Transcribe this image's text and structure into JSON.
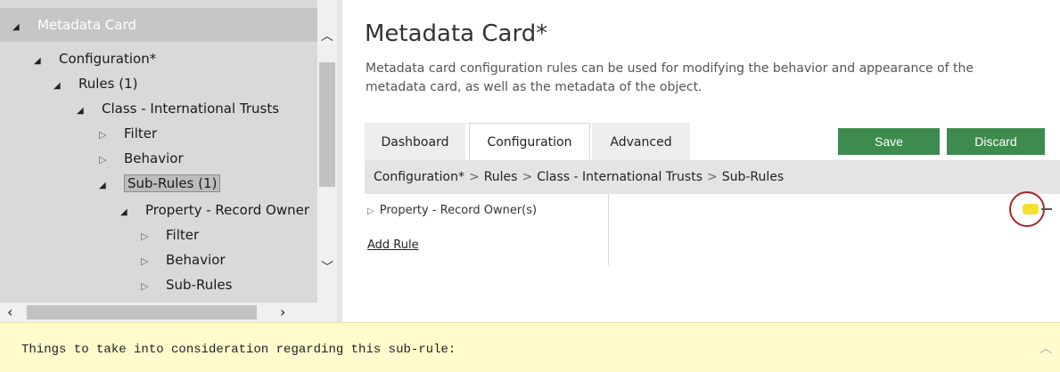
{
  "tree": {
    "header_label": "Metadata Card",
    "rows": [
      {
        "label": "Configuration*"
      },
      {
        "label": "Rules (1)"
      },
      {
        "label": "Class - International Trusts"
      },
      {
        "label": "Filter"
      },
      {
        "label": "Behavior"
      },
      {
        "label": "Sub-Rules (1)"
      },
      {
        "label": "Property - Record Owner"
      },
      {
        "label": "Filter"
      },
      {
        "label": "Behavior"
      },
      {
        "label": "Sub-Rules"
      }
    ]
  },
  "page": {
    "title": "Metadata Card*",
    "description": "Metadata card configuration rules can be used for modifying the behavior and appearance of the metadata card, as well as the metadata of the object."
  },
  "tabs": [
    {
      "label": "Dashboard"
    },
    {
      "label": "Configuration"
    },
    {
      "label": "Advanced"
    }
  ],
  "buttons": {
    "save": "Save",
    "discard": "Discard"
  },
  "breadcrumb": {
    "items": [
      "Configuration*",
      "Rules",
      "Class - International Trusts",
      "Sub-Rules"
    ],
    "separator": ">"
  },
  "rules": {
    "item_label": "Property - Record Owner(s)",
    "add_rule": "Add Rule"
  },
  "bottom": {
    "note": "Things to take into consideration regarding this sub-rule:"
  },
  "colors": {
    "accent_button": "#3d8b4e",
    "marker": "#a8262a",
    "note_bg": "#fffbcc"
  },
  "icons": {
    "expanded": "triangle-down-right",
    "collapsed": "triangle-right-outline"
  }
}
